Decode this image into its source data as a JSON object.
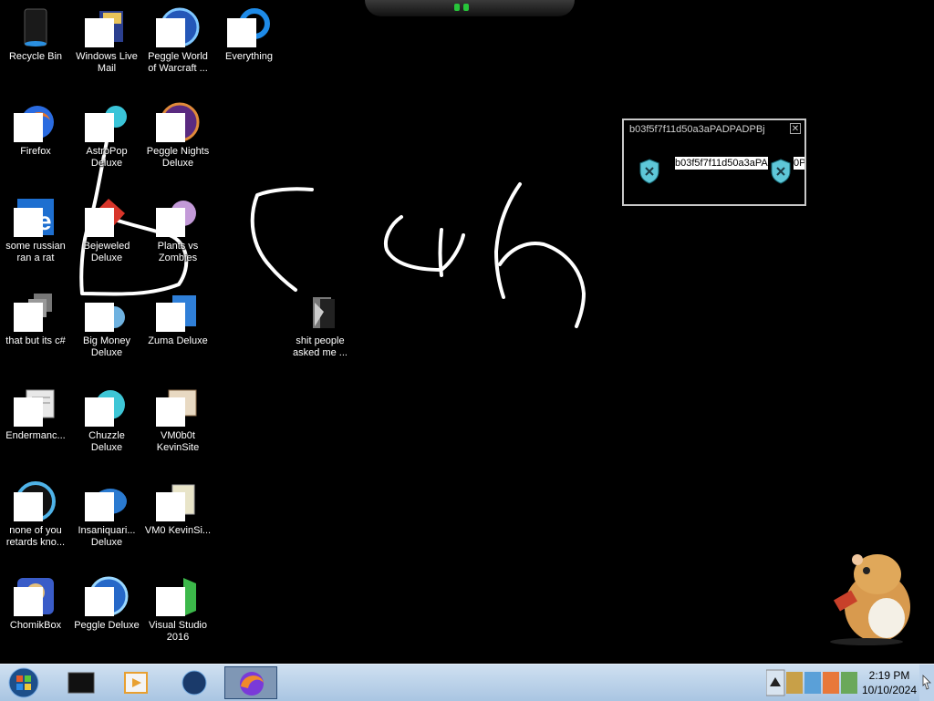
{
  "desktop": {
    "icons": [
      {
        "label": "Recycle Bin",
        "icon": "recycle-bin-icon"
      },
      {
        "label": "Windows Live Mail",
        "icon": "mail-icon"
      },
      {
        "label": "Peggle World of Warcraft ...",
        "icon": "peggle-icon"
      },
      {
        "label": "Everything",
        "icon": "everything-icon"
      },
      {
        "label": "Firefox",
        "icon": "firefox-icon"
      },
      {
        "label": "AstroPop Deluxe",
        "icon": "astropop-icon"
      },
      {
        "label": "Peggle Nights Deluxe",
        "icon": "peggle-nights-icon"
      },
      {
        "label": "some russian ran a rat",
        "icon": "ie-icon"
      },
      {
        "label": "Bejeweled Deluxe",
        "icon": "bejeweled-icon"
      },
      {
        "label": "Plants vs Zombies",
        "icon": "pvz-icon"
      },
      {
        "label": "that but its c#",
        "icon": "folder-stack-icon"
      },
      {
        "label": "Big Money Deluxe",
        "icon": "big-money-icon"
      },
      {
        "label": "Zuma Deluxe",
        "icon": "zuma-icon"
      },
      {
        "label": "Endermanc...",
        "icon": "document-icon"
      },
      {
        "label": "Chuzzle Deluxe",
        "icon": "chuzzle-icon"
      },
      {
        "label": "VM0b0t KevinSite",
        "icon": "vm-icon"
      },
      {
        "label": "none of you retards kno...",
        "icon": "blue-orb-icon"
      },
      {
        "label": "Insaniquari... Deluxe",
        "icon": "insaniquarium-icon"
      },
      {
        "label": "VM0 KevinSi...",
        "icon": "file-icon"
      },
      {
        "label": "ChomikBox",
        "icon": "chomikbox-icon"
      },
      {
        "label": "Peggle Deluxe",
        "icon": "peggle-deluxe-icon"
      },
      {
        "label": "Visual Studio 2016",
        "icon": "visual-studio-icon"
      },
      {
        "label": "shit people asked me ...",
        "icon": "folder-icon"
      }
    ]
  },
  "popup": {
    "title": "b03f5f7f11d50a3aPADPADPBj",
    "close_glyph": "✕",
    "field_text": "b03f5f7f11d50a3aPA",
    "field_text_right": "0P"
  },
  "taskbar": {
    "clock_time": "2:19 PM",
    "clock_date": "10/10/2024",
    "buttons": [
      {
        "icon": "terminal-icon"
      },
      {
        "icon": "media-player-icon"
      },
      {
        "icon": "globe-icon"
      },
      {
        "icon": "firefox-icon",
        "active": true
      }
    ]
  },
  "colors": {
    "desktop_bg": "#000000",
    "taskbar_top": "#cfe0f1",
    "taskbar_bottom": "#a9c5e2",
    "drawing_stroke": "#ffffff"
  }
}
